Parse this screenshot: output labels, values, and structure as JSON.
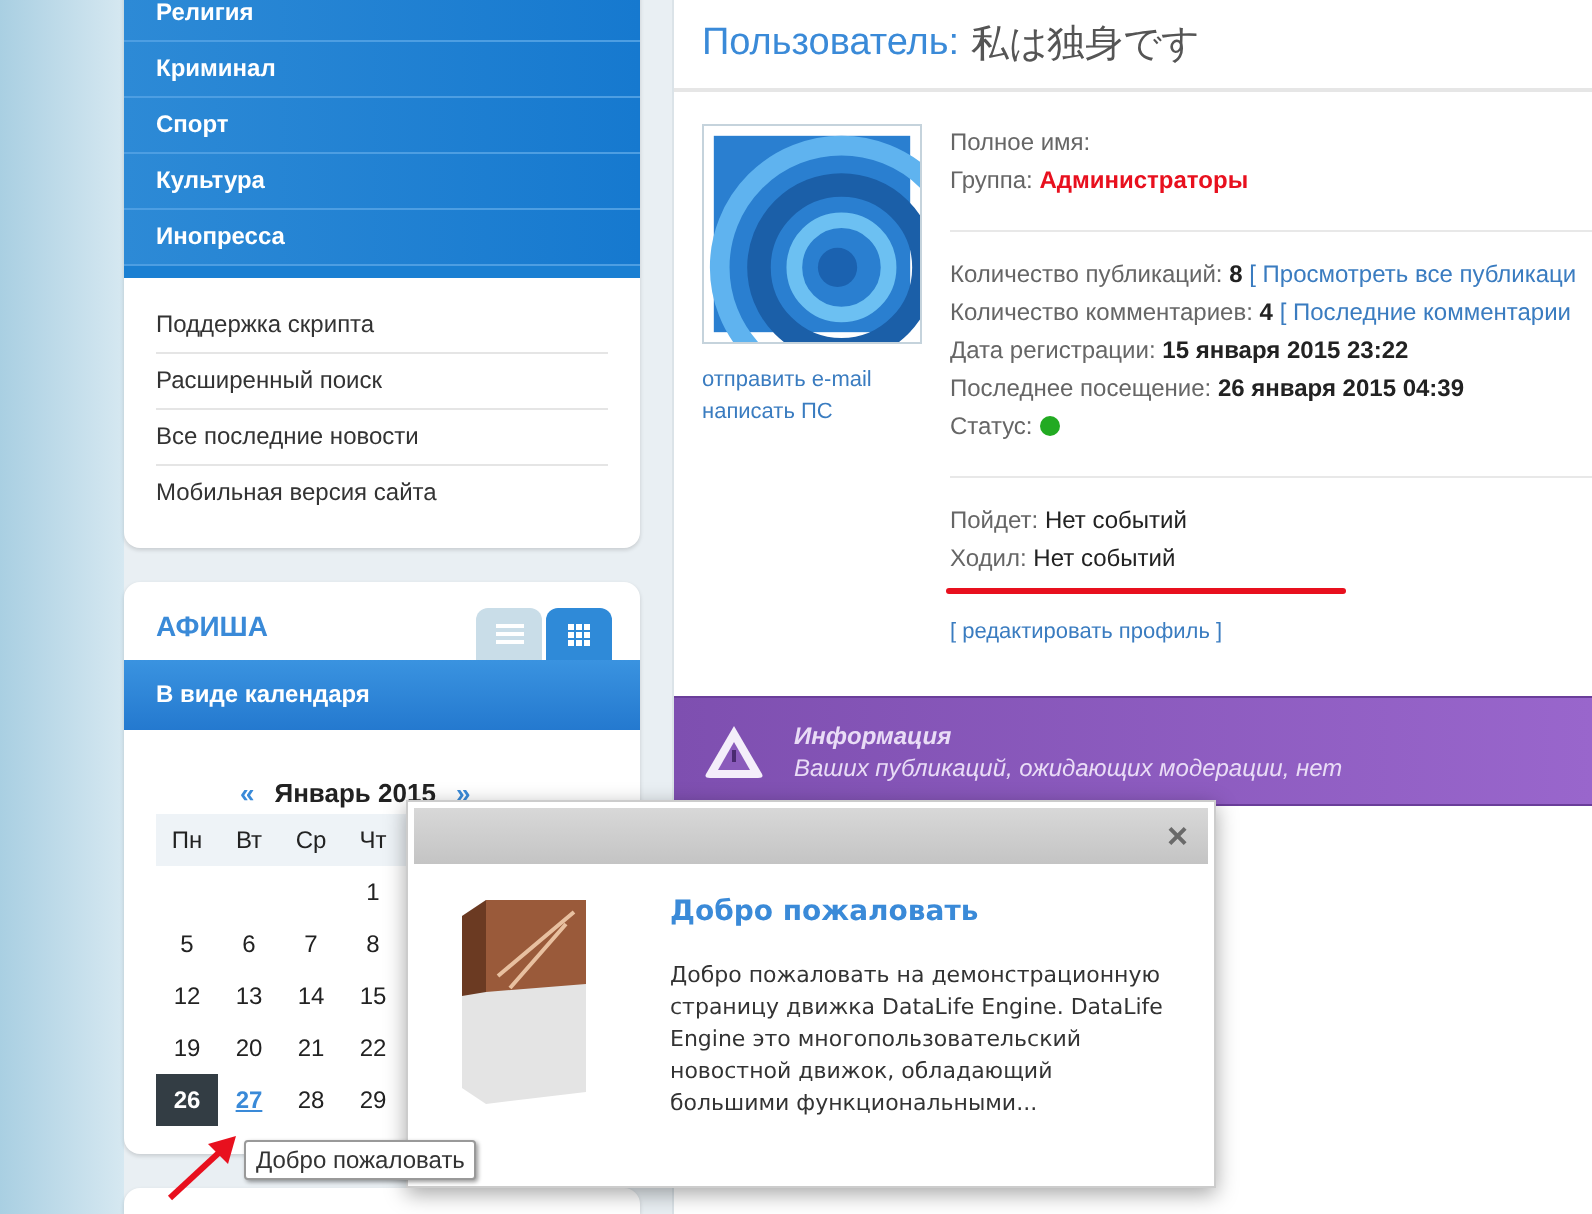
{
  "sidebar": {
    "categories": [
      "Религия",
      "Криминал",
      "Спорт",
      "Культура",
      "Инопресса"
    ],
    "links": [
      "Поддержка скрипта",
      "Расширенный поиск",
      "Все последние новости",
      "Мобильная версия сайта"
    ]
  },
  "afisha": {
    "title": "АФИША",
    "view_tabs": [
      {
        "kind": "list",
        "selected": false
      },
      {
        "kind": "grid",
        "selected": true
      }
    ],
    "bar": "В виде календаря",
    "calendar": {
      "prev": "«",
      "month": "Январь 2015",
      "next": "»",
      "weekdays": [
        "Пн",
        "Вт",
        "Ср",
        "Чт"
      ],
      "weeks": [
        [
          {
            "day": "1"
          }
        ],
        [
          {
            "day": "5"
          },
          {
            "day": "6"
          },
          {
            "day": "7"
          },
          {
            "day": "8"
          }
        ],
        [
          {
            "day": "12"
          },
          {
            "day": "13"
          },
          {
            "day": "14"
          },
          {
            "day": "15"
          }
        ],
        [
          {
            "day": "19"
          },
          {
            "day": "20"
          },
          {
            "day": "21"
          },
          {
            "day": "22"
          }
        ],
        [
          {
            "day": "26",
            "selected": true,
            "link": false
          },
          {
            "day": "27",
            "selected": false,
            "link": true
          },
          {
            "day": "28",
            "selected": false,
            "link": false
          },
          {
            "day": "29",
            "selected": false,
            "link": false
          }
        ]
      ]
    },
    "tooltip": "Добро пожаловать"
  },
  "profile": {
    "title_label": "Пользователь:",
    "username": "私は独身です",
    "actions": [
      "отправить e-mail",
      "написать ПС"
    ],
    "full_name_label": "Полное имя:",
    "group_label": "Группа:",
    "group_value": "Администраторы",
    "stats": [
      {
        "label": "Количество публикаций:",
        "value": "8",
        "link": "[ Просмотреть все публикаци"
      },
      {
        "label": "Количество комментариев:",
        "value": "4",
        "link": "[ Последние комментарии"
      },
      {
        "label": "Дата регистрации:",
        "value": "15 января 2015 23:22"
      },
      {
        "label": "Последнее посещение:",
        "value": "26 января 2015 04:39"
      }
    ],
    "status_label": "Статус:",
    "online": true,
    "events": [
      {
        "label": "Пойдет:",
        "value": "Нет событий"
      },
      {
        "label": "Ходил:",
        "value": "Нет событий"
      }
    ],
    "edit_link": "[ редактировать профиль ]"
  },
  "info": {
    "title": "Информация",
    "text": "Ваших публикаций, ожидающих модерации, нет"
  },
  "popup": {
    "title": "Добро пожаловать",
    "text": "Добро пожаловать на демонстрационную страницу движка DataLife Engine. DataLife Engine это многопользовательский новостной движок, обладающий большими функциональными...",
    "close": "×"
  }
}
